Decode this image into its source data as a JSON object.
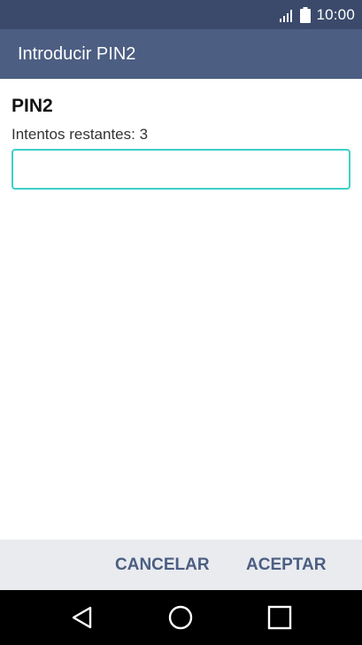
{
  "status_bar": {
    "time": "10:00",
    "icons": [
      "signal-icon",
      "battery-icon"
    ]
  },
  "app_bar": {
    "title": "Introducir PIN2"
  },
  "form": {
    "heading": "PIN2",
    "attempts_label": "Intentos restantes: 3",
    "pin_value": "",
    "pin_placeholder": ""
  },
  "buttons": {
    "cancel": "CANCELAR",
    "accept": "ACEPTAR"
  },
  "nav_bar": {
    "icons": [
      "back-icon",
      "home-icon",
      "recent-apps-icon"
    ]
  },
  "colors": {
    "status_bar": "#3b4a6b",
    "app_bar": "#4c5e82",
    "input_focus_border": "#3fcfc8",
    "button_text": "#4c5e82",
    "button_bar": "#e9ebef",
    "nav_bar": "#000000"
  }
}
